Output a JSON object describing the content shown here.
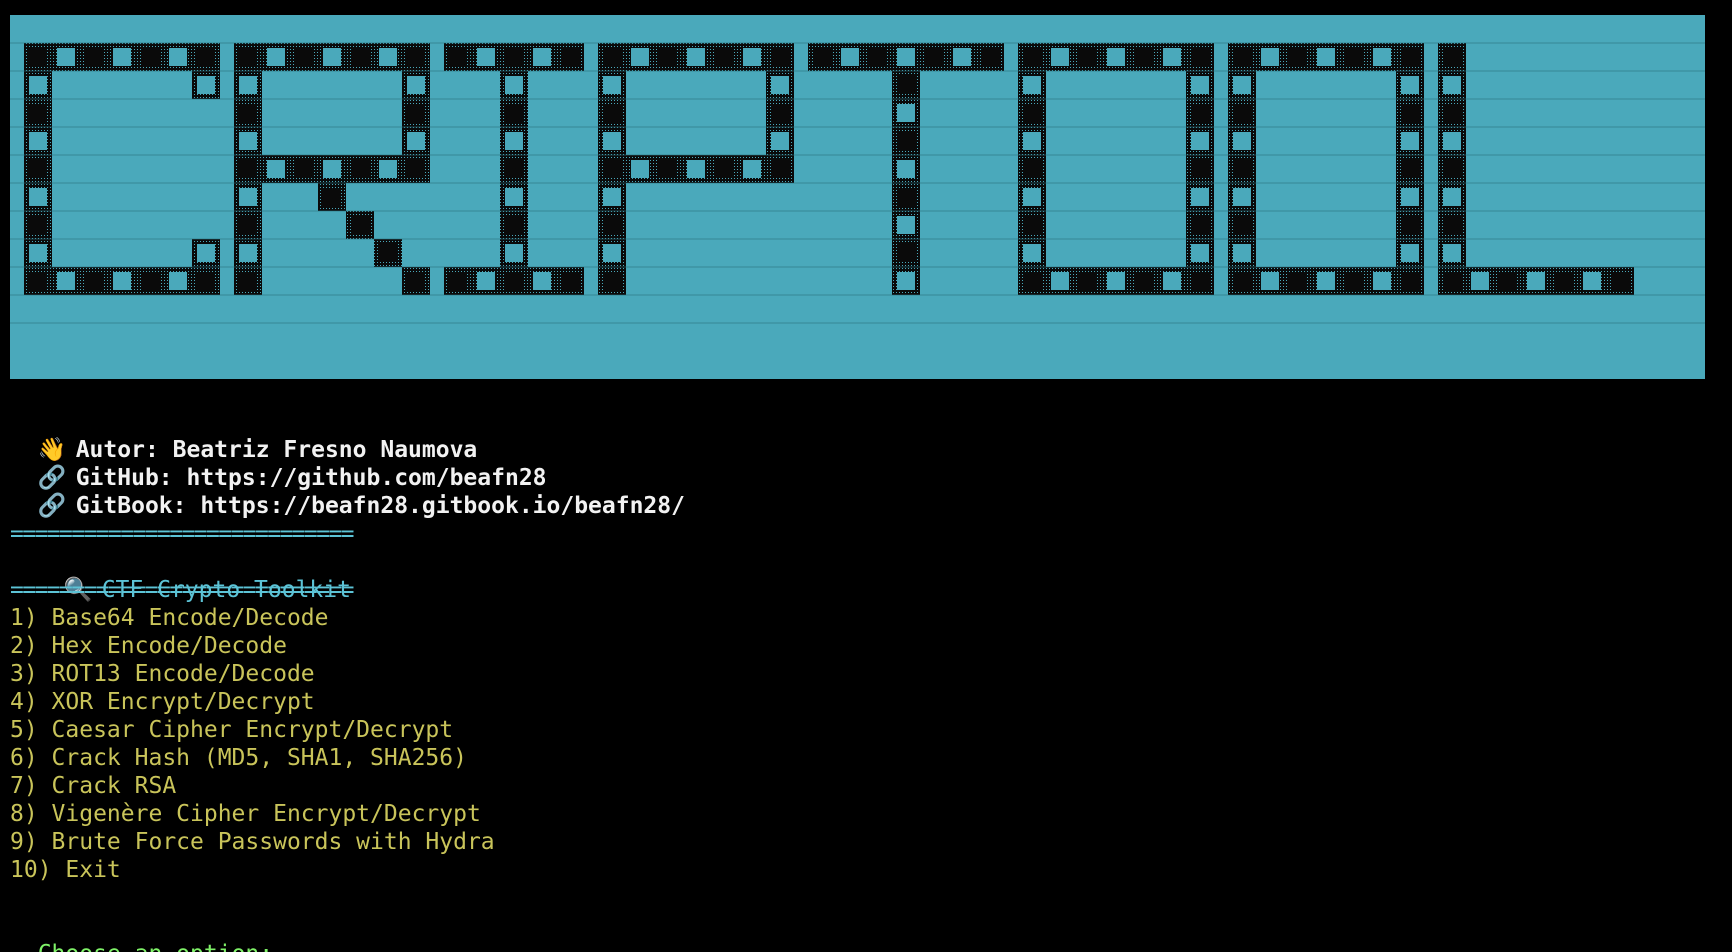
{
  "banner": {
    "word": "CRIPTOOL",
    "colors": {
      "background": "#4aa9bb",
      "dark": "#0a0a0a",
      "check_light": "#4aa9bb",
      "row_line": "#2b6f7d"
    }
  },
  "credits": [
    {
      "icon": "waving-hand-icon",
      "glyph": "👋",
      "text": "Autor: Beatriz Fresno Naumova"
    },
    {
      "icon": "link-icon",
      "glyph": "🔗",
      "text": "GitHub: https://github.com/beafn28"
    },
    {
      "icon": "link-icon",
      "glyph": "🔗",
      "text": "GitBook: https://beafn28.gitbook.io/beafn28/"
    }
  ],
  "header": {
    "separator": "============================",
    "icon": "magnifier-icon",
    "glyph": "🔍",
    "title": "CTF Crypto Toolkit"
  },
  "menu": [
    "1) Base64 Encode/Decode",
    "2) Hex Encode/Decode",
    "3) ROT13 Encode/Decode",
    "4) XOR Encrypt/Decrypt",
    "5) Caesar Cipher Encrypt/Decrypt",
    "6) Crack Hash (MD5, SHA1, SHA256)",
    "7) Crack RSA",
    "8) Vigenère Cipher Encrypt/Decrypt",
    "9) Brute Force Passwords with Hydra",
    "10) Exit"
  ],
  "prompt": "Choose an option: ",
  "colors": {
    "terminal_bg": "#000000",
    "credit_text": "#f2f2f2",
    "header": "#5cc3d6",
    "menu": "#c9c45a",
    "prompt": "#7ff268"
  }
}
